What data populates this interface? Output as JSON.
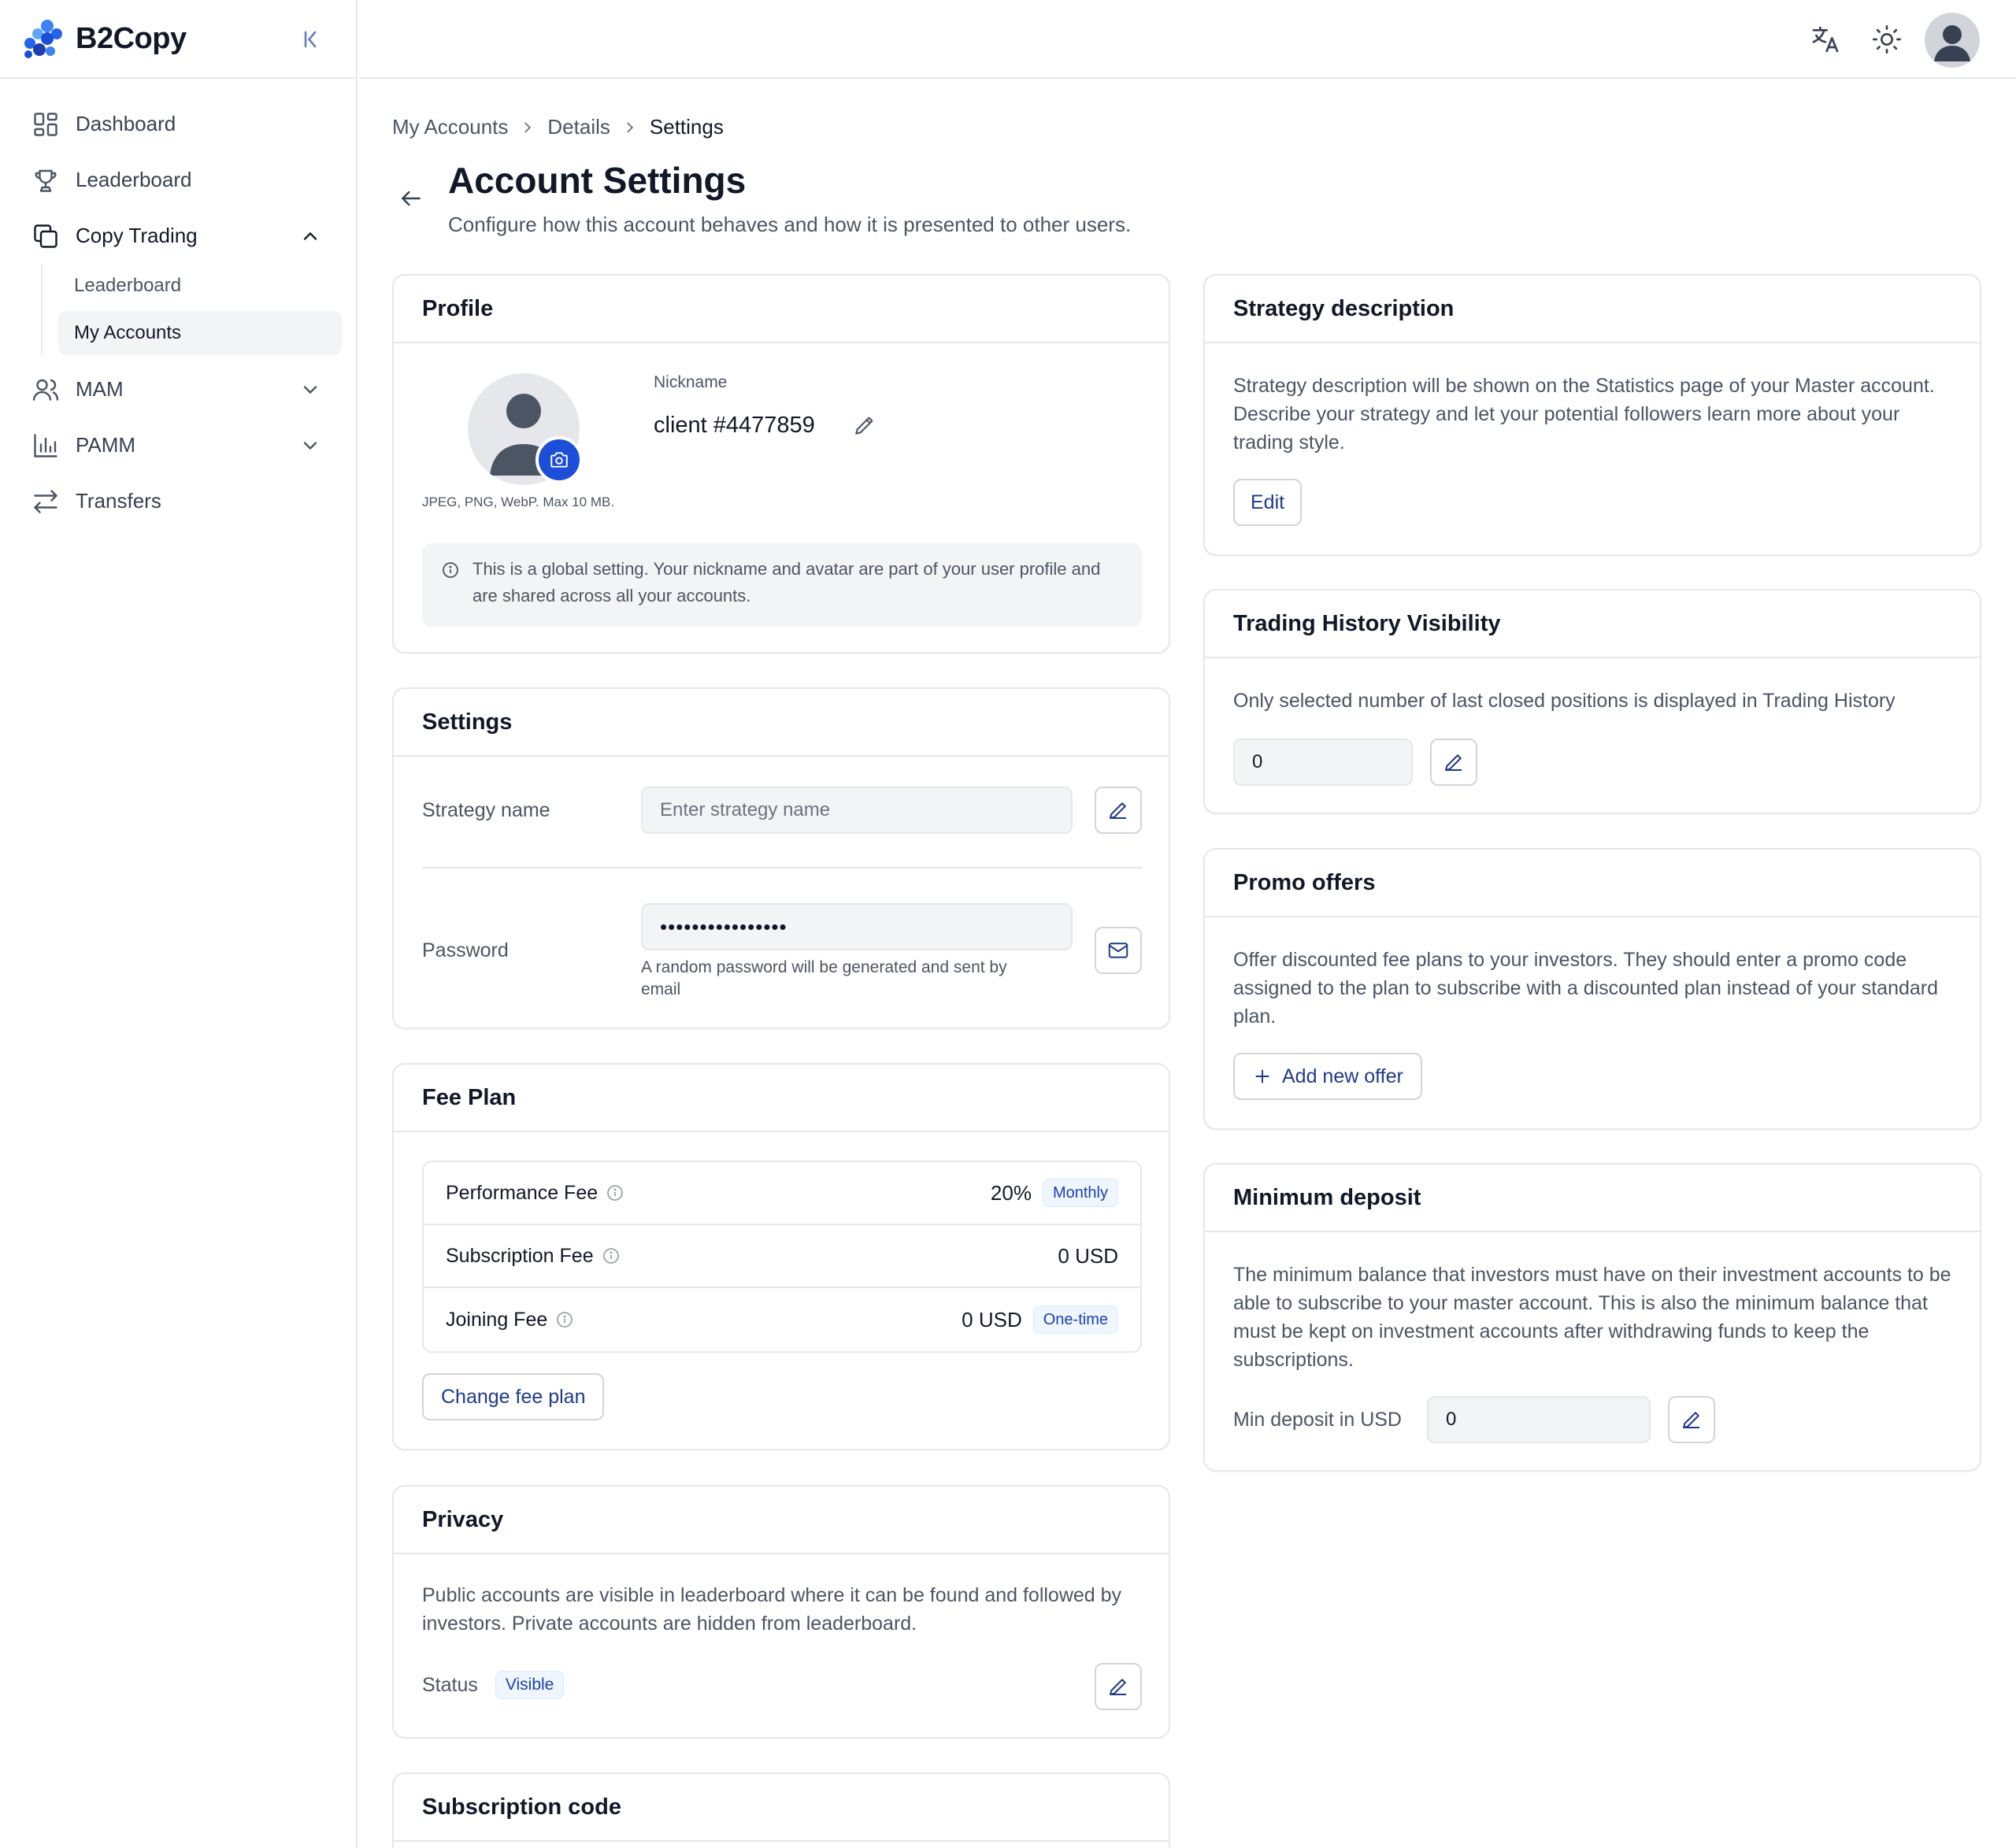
{
  "app": {
    "name": "B2Copy",
    "brand_colors": [
      "#2563eb",
      "#1d4ed8",
      "#3b82f6"
    ]
  },
  "sidebar": {
    "items": [
      {
        "label": "Dashboard",
        "icon": "dashboard-icon"
      },
      {
        "label": "Leaderboard",
        "icon": "trophy-icon"
      },
      {
        "label": "Copy Trading",
        "icon": "copy-icon",
        "expanded": true
      },
      {
        "label": "MAM",
        "icon": "users-icon",
        "expanded": false
      },
      {
        "label": "PAMM",
        "icon": "bar-chart-icon",
        "expanded": false
      },
      {
        "label": "Transfers",
        "icon": "transfer-icon"
      }
    ],
    "copy_trading_sub": [
      {
        "label": "Leaderboard",
        "active": false
      },
      {
        "label": "My Accounts",
        "active": true
      }
    ]
  },
  "breadcrumb": [
    "My Accounts",
    "Details",
    "Settings"
  ],
  "page": {
    "title": "Account Settings",
    "subtitle": "Configure how this account behaves and how it is presented to other users."
  },
  "profile": {
    "title": "Profile",
    "avatar_hint": "JPEG, PNG, WebP. Max 10 MB.",
    "nickname_label": "Nickname",
    "nickname": "client #4477859",
    "notice": "This is a global setting. Your nickname and avatar are part of your user profile and are shared across all your accounts."
  },
  "settings": {
    "title": "Settings",
    "strategy_label": "Strategy name",
    "strategy_placeholder": "Enter strategy name",
    "password_label": "Password",
    "password_value": "••••••••••••••••",
    "password_hint": "A random password will be generated and sent by email"
  },
  "fee_plan": {
    "title": "Fee Plan",
    "rows": [
      {
        "label": "Performance Fee",
        "value": "20%",
        "badge": "Monthly"
      },
      {
        "label": "Subscription Fee",
        "value": "0 USD",
        "badge": ""
      },
      {
        "label": "Joining Fee",
        "value": "0 USD",
        "badge": "One-time"
      }
    ],
    "change_button": "Change fee plan"
  },
  "privacy": {
    "title": "Privacy",
    "text": "Public accounts are visible in leaderboard where it can be found and followed by investors. Private accounts are hidden from leaderboard.",
    "status_label": "Status",
    "status_value": "Visible"
  },
  "subscription_code": {
    "title": "Subscription code"
  },
  "strategy_description": {
    "title": "Strategy description",
    "text": "Strategy description will be shown on the Statistics page of your Master account. Describe your strategy and let your potential followers learn more about your trading style.",
    "edit_button": "Edit"
  },
  "trading_history": {
    "title": "Trading History Visibility",
    "text": "Only selected number of last closed positions is displayed in Trading History",
    "value": "0"
  },
  "promo": {
    "title": "Promo offers",
    "text": "Offer discounted fee plans to your investors. They should enter a promo code assigned to the plan to subscribe with a discounted plan instead of your standard plan.",
    "add_button": "Add new offer"
  },
  "min_deposit": {
    "title": "Minimum deposit",
    "text": "The minimum balance that investors must have on their investment accounts to be able to subscribe to your master account. This is also the minimum balance that must be kept on investment accounts after withdrawing funds to keep the subscriptions.",
    "label": "Min deposit in USD",
    "value": "0"
  }
}
